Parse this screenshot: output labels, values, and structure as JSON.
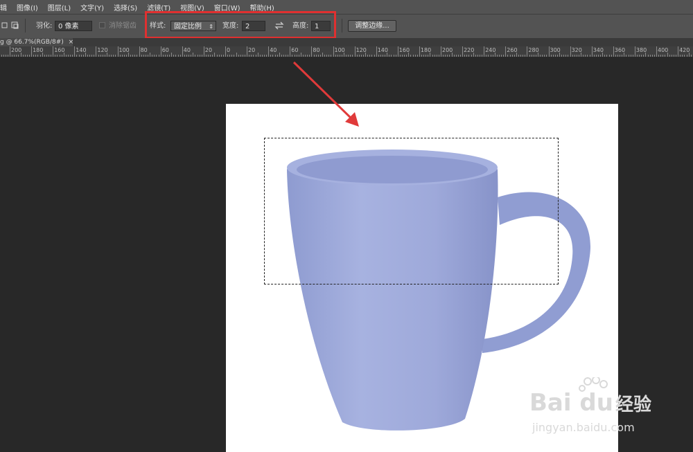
{
  "menu": [
    "辑",
    "图像(I)",
    "图层(L)",
    "文字(Y)",
    "选择(S)",
    "滤镜(T)",
    "视图(V)",
    "窗口(W)",
    "帮助(H)"
  ],
  "options": {
    "feather_label": "羽化:",
    "feather_value": "0 像素",
    "antialias_label": "消除锯齿",
    "style_label": "样式:",
    "style_value": "固定比例",
    "width_label": "宽度:",
    "width_value": "2",
    "height_label": "高度:",
    "height_value": "1",
    "refine_button": "调整边缘..."
  },
  "document_tab": {
    "title": "g @ 66.7%(RGB/8#)",
    "close": "×"
  },
  "ruler": {
    "labels": [
      "200",
      "180",
      "160",
      "140",
      "120",
      "100",
      "80",
      "60",
      "40",
      "20",
      "0",
      "20",
      "40",
      "60",
      "80",
      "100",
      "120",
      "140",
      "160",
      "180",
      "200",
      "220",
      "240",
      "260",
      "280",
      "300",
      "320",
      "340",
      "360",
      "380",
      "400",
      "420"
    ]
  },
  "watermark": {
    "brand": "Bai du",
    "brand_cn": "经验",
    "url": "jingyan.baidu.com"
  },
  "colors": {
    "highlight": "#e03030",
    "mug": "#9aa7d8"
  }
}
